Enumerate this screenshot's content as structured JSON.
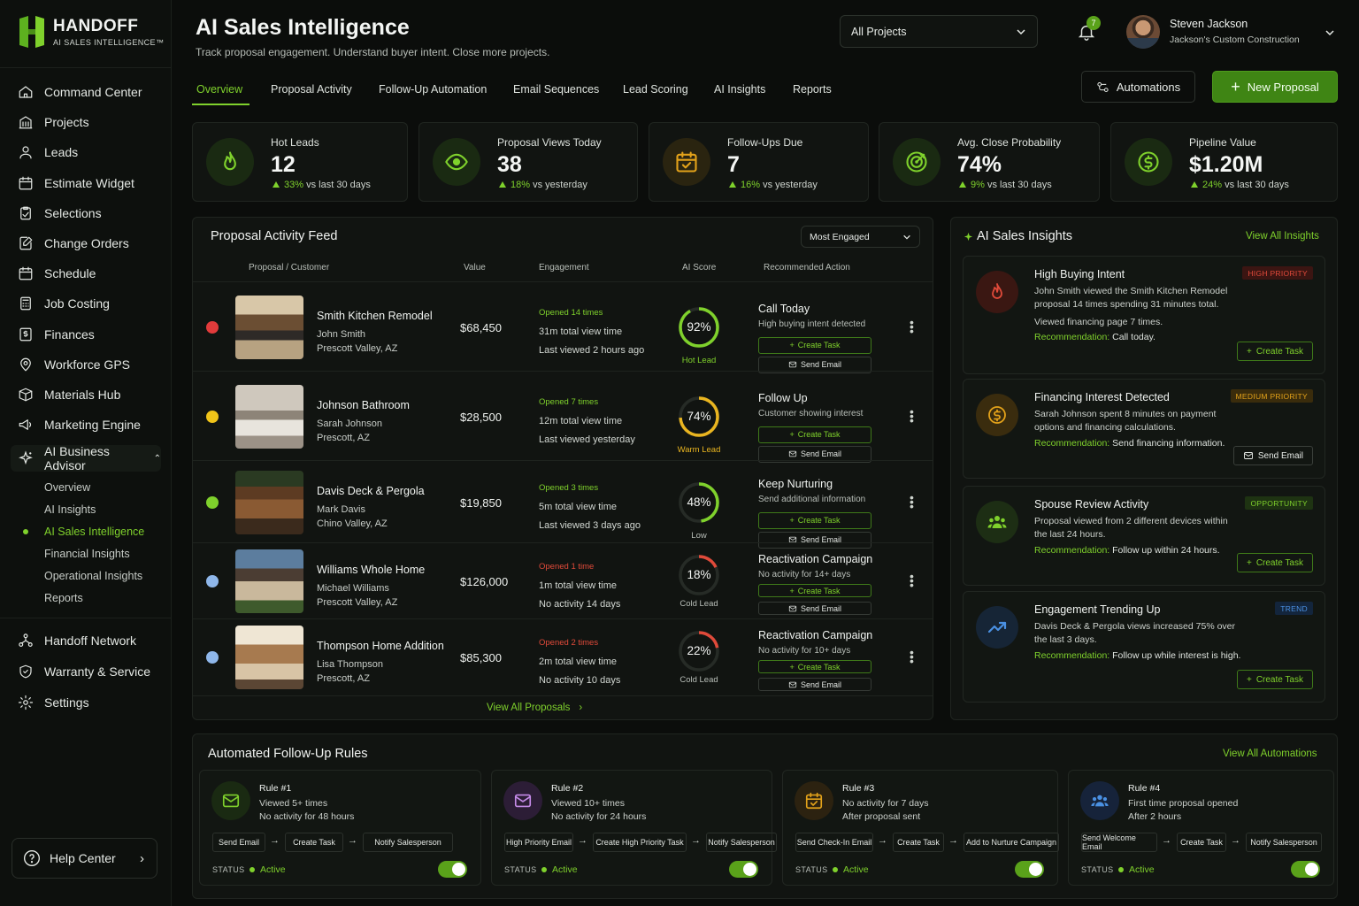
{
  "brand": {
    "name": "HANDOFF",
    "tagline": "AI SALES INTELLIGENCE™"
  },
  "sidebar": {
    "items": [
      {
        "label": "Command Center",
        "icon": "home-icon"
      },
      {
        "label": "Projects",
        "icon": "building-icon"
      },
      {
        "label": "Leads",
        "icon": "user-icon"
      },
      {
        "label": "Estimate Widget",
        "icon": "calendar-icon"
      },
      {
        "label": "Selections",
        "icon": "clipboard-icon"
      },
      {
        "label": "Change Orders",
        "icon": "edit-doc-icon"
      },
      {
        "label": "Schedule",
        "icon": "calendar-icon"
      },
      {
        "label": "Job Costing",
        "icon": "calculator-icon"
      },
      {
        "label": "Finances",
        "icon": "dollar-doc-icon"
      },
      {
        "label": "Workforce GPS",
        "icon": "location-pin-icon"
      },
      {
        "label": "Materials Hub",
        "icon": "box-icon"
      },
      {
        "label": "Marketing Engine",
        "icon": "megaphone-icon"
      }
    ],
    "advisor": {
      "label": "AI Business Advisor",
      "icon": "sparkle-icon"
    },
    "advisor_sub": [
      "Overview",
      "AI Insights",
      "AI Sales Intelligence",
      "Financial Insights",
      "Operational Insights",
      "Reports"
    ],
    "bottom": [
      {
        "label": "Handoff Network",
        "icon": "network-icon"
      },
      {
        "label": "Warranty & Service",
        "icon": "shield-icon"
      },
      {
        "label": "Settings",
        "icon": "gear-icon"
      }
    ],
    "help": "Help Center"
  },
  "header": {
    "title": "AI Sales Intelligence",
    "subtitle": "Track proposal engagement. Understand buyer intent. Close more projects.",
    "project_select": "All Projects",
    "notifications": "7",
    "user_name": "Steven Jackson",
    "user_company": "Jackson's Custom Construction"
  },
  "tabs": [
    "Overview",
    "Proposal Activity",
    "Follow-Up Automation",
    "Email Sequences",
    "Lead Scoring",
    "AI Insights",
    "Reports"
  ],
  "actions": {
    "automations": "Automations",
    "new_proposal": "New Proposal"
  },
  "kpis": [
    {
      "label": "Hot Leads",
      "value": "12",
      "delta": "33%",
      "period": "vs last 30 days",
      "icon": "flame-icon",
      "color": "#7fd12c"
    },
    {
      "label": "Proposal Views Today",
      "value": "38",
      "delta": "18%",
      "period": "vs yesterday",
      "icon": "eye-icon",
      "color": "#7fd12c"
    },
    {
      "label": "Follow-Ups Due",
      "value": "7",
      "delta": "16%",
      "period": "vs yesterday",
      "icon": "calendar-check-icon",
      "color": "#e3a21a"
    },
    {
      "label": "Avg. Close Probability",
      "value": "74%",
      "delta": "9%",
      "period": "vs last 30 days",
      "icon": "target-icon",
      "color": "#7fd12c"
    },
    {
      "label": "Pipeline Value",
      "value": "$1.20M",
      "delta": "24%",
      "period": "vs last 30 days",
      "icon": "dollar-icon",
      "color": "#7fd12c"
    }
  ],
  "feed": {
    "title": "Proposal Activity Feed",
    "sort": "Most Engaged",
    "columns": [
      "Proposal / Customer",
      "Value",
      "Engagement",
      "AI Score",
      "Recommended Action"
    ],
    "create_task": "Create Task",
    "send_email": "Send Email",
    "view_all": "View All Proposals",
    "rows": [
      {
        "name": "Smith Kitchen Remodel",
        "customer": "John Smith",
        "location": "Prescott Valley, AZ",
        "value": "$68,450",
        "opened": "Opened 14 times",
        "view_time": "31m total view time",
        "last": "Last viewed 2 hours ago",
        "score": 92,
        "score_label": "Hot Lead",
        "score_color": "#7fd12c",
        "action": "Call Today",
        "action_sub": "High buying intent detected",
        "dot": "#e23b3b"
      },
      {
        "name": "Johnson Bathroom",
        "customer": "Sarah Johnson",
        "location": "Prescott, AZ",
        "value": "$28,500",
        "opened": "Opened 7 times",
        "view_time": "12m total view time",
        "last": "Last viewed yesterday",
        "score": 74,
        "score_label": "Warm Lead",
        "score_color": "#e9b520",
        "action": "Follow Up",
        "action_sub": "Customer showing interest",
        "dot": "#f0c419"
      },
      {
        "name": "Davis Deck & Pergola",
        "customer": "Mark Davis",
        "location": "Chino Valley, AZ",
        "value": "$19,850",
        "opened": "Opened 3 times",
        "view_time": "5m total view time",
        "last": "Last viewed 3 days ago",
        "score": 48,
        "score_label": "Low",
        "score_color": "#7fd12c",
        "action": "Keep Nurturing",
        "action_sub": "Send additional information",
        "dot": "#7fd12c"
      },
      {
        "name": "Williams Whole Home",
        "customer": "Michael Williams",
        "location": "Prescott Valley, AZ",
        "value": "$126,000",
        "opened": "Opened 1 time",
        "view_time": "1m total view time",
        "last": "No activity 14 days",
        "score": 18,
        "score_label": "Cold Lead",
        "score_color": "#e04a3a",
        "action": "Reactivation Campaign",
        "action_sub": "No activity for 14+ days",
        "dot": "#8fb7ea"
      },
      {
        "name": "Thompson Home Addition",
        "customer": "Lisa Thompson",
        "location": "Prescott, AZ",
        "value": "$85,300",
        "opened": "Opened 2 times",
        "view_time": "2m total view time",
        "last": "No activity 10 days",
        "score": 22,
        "score_label": "Cold Lead",
        "score_color": "#e04a3a",
        "action": "Reactivation Campaign",
        "action_sub": "No activity for 10+ days",
        "dot": "#8fb7ea"
      }
    ]
  },
  "insights": {
    "title": "AI Sales Insights",
    "view_all": "View All Insights",
    "items": [
      {
        "title": "High Buying Intent",
        "badge": "HIGH PRIORITY",
        "badge_color": "#e04a3a",
        "body": "John Smith viewed the Smith Kitchen Remodel proposal 14 times spending 31 minutes total.",
        "extra": "Viewed financing page 7 times.",
        "rec_label": "Recommendation:",
        "rec": "Call today.",
        "button": "Create Task",
        "icon": "flame-icon"
      },
      {
        "title": "Financing Interest Detected",
        "badge": "MEDIUM PRIORITY",
        "badge_color": "#e3a21a",
        "body": "Sarah Johnson spent 8 minutes on payment options and financing calculations.",
        "rec_label": "Recommendation:",
        "rec": "Send financing information.",
        "button": "Send Email",
        "icon": "dollar-icon"
      },
      {
        "title": "Spouse Review Activity",
        "badge": "OPPORTUNITY",
        "badge_color": "#7fd12c",
        "body": "Proposal viewed from 2 different devices within the last 24 hours.",
        "rec_label": "Recommendation:",
        "rec": "Follow up within 24 hours.",
        "button": "Create Task",
        "icon": "users-icon"
      },
      {
        "title": "Engagement Trending Up",
        "badge": "TREND",
        "badge_color": "#4a90e2",
        "body": "Davis Deck & Pergola views increased 75% over the last 3 days.",
        "rec_label": "Recommendation:",
        "rec": "Follow up while interest is high.",
        "button": "Create Task",
        "icon": "trend-up-icon"
      }
    ]
  },
  "rules": {
    "title": "Automated Follow-Up Rules",
    "view_all": "View All Automations",
    "status_label": "STATUS",
    "items": [
      {
        "title": "Rule #1",
        "c1": "Viewed 5+ times",
        "c2": "No activity for 48 hours",
        "steps": [
          "Send Email",
          "Create Task",
          "Notify Salesperson"
        ],
        "status": "Active",
        "icon": "mail-icon"
      },
      {
        "title": "Rule #2",
        "c1": "Viewed 10+ times",
        "c2": "No activity for 24 hours",
        "steps": [
          "High Priority Email",
          "Create High Priority Task",
          "Notify Salesperson"
        ],
        "status": "Active",
        "icon": "mail-icon"
      },
      {
        "title": "Rule #3",
        "c1": "No activity for 7 days",
        "c2": "After proposal sent",
        "steps": [
          "Send Check-In Email",
          "Create Task",
          "Add to Nurture Campaign"
        ],
        "status": "Active",
        "icon": "calendar-check-icon"
      },
      {
        "title": "Rule #4",
        "c1": "First time proposal opened",
        "c2": "After 2 hours",
        "steps": [
          "Send Welcome Email",
          "Create Task",
          "Notify Salesperson"
        ],
        "status": "Active",
        "icon": "users-icon"
      }
    ]
  }
}
